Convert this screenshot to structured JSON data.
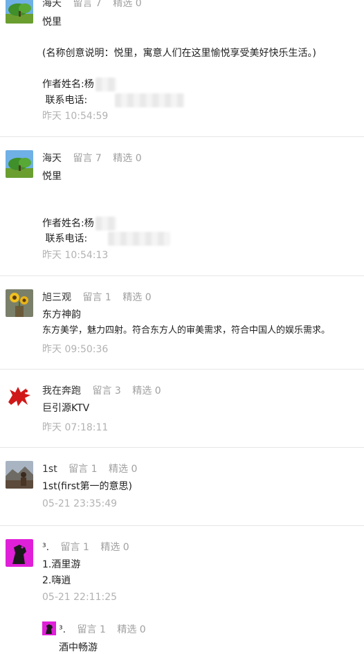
{
  "comments": [
    {
      "nickname": "海天",
      "msg_label": "留言",
      "msg_count": "7",
      "pick_label": "精选",
      "pick_count": "0",
      "lines": [
        "悦里",
        "",
        "(名称创意说明：悦里，寓意人们在这里愉悦享受美好快乐生活。)",
        "",
        "作者姓名:杨",
        " 联系电话:"
      ],
      "time": "昨天 10:54:59",
      "avatar_icon": "tree-landscape-avatar"
    },
    {
      "nickname": "海天",
      "msg_label": "留言",
      "msg_count": "7",
      "pick_label": "精选",
      "pick_count": "0",
      "lines": [
        "悦里",
        "",
        "",
        "作者姓名:杨",
        " 联系电话:"
      ],
      "time": "昨天 10:54:13",
      "avatar_icon": "tree-landscape-avatar"
    },
    {
      "nickname": "旭三观",
      "msg_label": "留言",
      "msg_count": "1",
      "pick_label": "精选",
      "pick_count": "0",
      "lines": [
        "东方神韵",
        "东方美学，魅力四射。符合东方人的审美需求，符合中国人的娱乐需求。"
      ],
      "time": "昨天 09:50:36",
      "avatar_icon": "sunflower-avatar"
    },
    {
      "nickname": "我在奔跑",
      "msg_label": "留言",
      "msg_count": "3",
      "pick_label": "精选",
      "pick_count": "0",
      "lines": [
        "巨引源KTV"
      ],
      "time": "昨天 07:18:11",
      "avatar_icon": "red-horse-avatar"
    },
    {
      "nickname": "1st",
      "msg_label": "留言",
      "msg_count": "1",
      "pick_label": "精选",
      "pick_count": "0",
      "lines": [
        "1st(first第一的意思)"
      ],
      "time": "05-21 23:35:49",
      "avatar_icon": "mountain-person-avatar"
    },
    {
      "nickname": "³.",
      "msg_label": "留言",
      "msg_count": "1",
      "pick_label": "精选",
      "pick_count": "0",
      "lines": [
        "1.酒里游",
        "2.嗨逍"
      ],
      "time": "05-21 22:11:25",
      "avatar_icon": "magenta-figure-avatar",
      "reply": {
        "nickname": "³.",
        "msg_label": "留言",
        "msg_count": "1",
        "pick_label": "精选",
        "pick_count": "0",
        "text": "酒中畅游"
      }
    }
  ]
}
